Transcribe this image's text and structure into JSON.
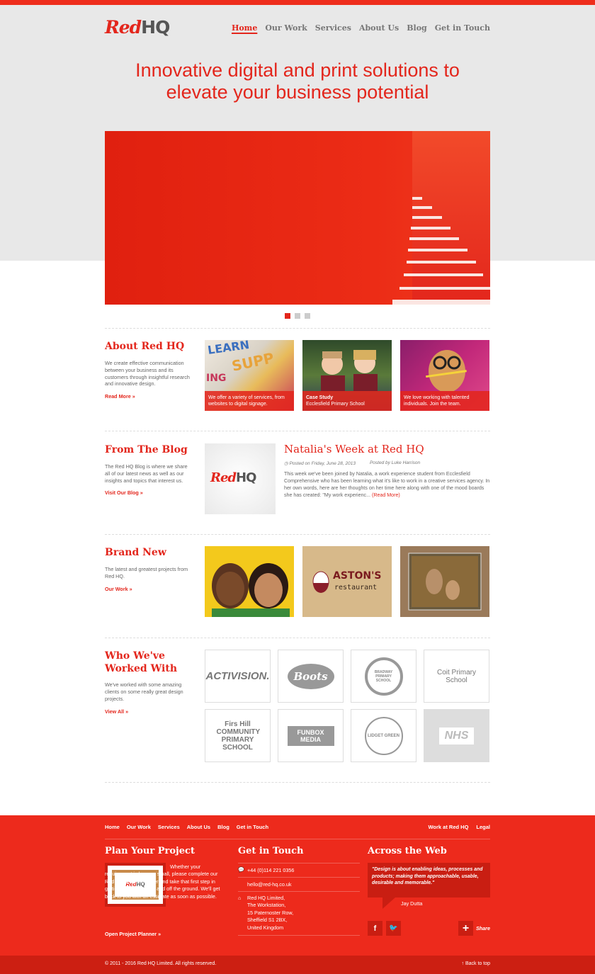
{
  "brand": {
    "logo_red": "Red",
    "logo_grey": "HQ"
  },
  "nav": [
    {
      "label": "Home",
      "active": true
    },
    {
      "label": "Our Work"
    },
    {
      "label": "Services"
    },
    {
      "label": "About Us"
    },
    {
      "label": "Blog"
    },
    {
      "label": "Get in Touch"
    }
  ],
  "hero": {
    "tagline_line1": "Innovative digital and print solutions to",
    "tagline_line2": "elevate your business potential"
  },
  "about": {
    "title": "About Red HQ",
    "text": "We create effective communication between your business and its customers through insightful research and innovative design.",
    "link": "Read More »",
    "tiles": [
      {
        "caption": "We offer a variety of services, from websites to digital signage."
      },
      {
        "caption_bold": "Case Study",
        "caption": "Ecclesfield Primary School"
      },
      {
        "caption": "We love working with talented individuals. Join the team."
      }
    ]
  },
  "blog": {
    "title": "From The Blog",
    "text": "The Red HQ Blog is where we share all of our latest news as well as our insights and topics that interest us.",
    "link": "Visit Our Blog »",
    "post_title": "Natalia's Week at Red HQ",
    "post_date": "Posted on Friday, June 28, 2013",
    "post_author": "Posted by Luke Harrison",
    "excerpt": "This week we've been joined by Natalia, a work experience student from Ecclesfield Comprehensive who has been learning what it's like to work in a creative services agency. In her own words, here are her thoughts on her time here along with one of the mood boards she has created: \"My work experienc...",
    "read_more": "(Read More)",
    "thumb_logo_red": "Red",
    "thumb_logo_grey": "HQ"
  },
  "brand_new": {
    "title": "Brand New",
    "text": "The latest and greatest projects from Red HQ.",
    "link": "Our Work »",
    "aston_name": "ASTON'S",
    "aston_sub": "restaurant"
  },
  "clients": {
    "title_line1": "Who We've",
    "title_line2": "Worked With",
    "text": "We've worked with some amazing clients on some really great design projects.",
    "link": "View All »",
    "logos": [
      "ACTIVISION.",
      "Boots",
      "BRADWAY PRIMARY SCHOOL",
      "Coit Primary School",
      "Firs Hill COMMUNITY PRIMARY SCHOOL",
      "FUNBOX MEDIA",
      "LIDGET GREEN",
      "NHS"
    ]
  },
  "footer": {
    "nav_left": [
      "Home",
      "Our Work",
      "Services",
      "About Us",
      "Blog",
      "Get in Touch"
    ],
    "nav_right": [
      "Work at Red HQ",
      "Legal"
    ],
    "plan_title": "Plan Your Project",
    "plan_text": "Whether your requirement is large or small, please complete our Red HQ project planner and take that first step in getting your project up and off the ground. We'll get back to you with an estimate as soon as possible.",
    "plan_link": "Open Project Planner »",
    "contact_title": "Get in Touch",
    "phone": "+44 (0)114 221 0356",
    "email": "hello@red-hq.co.uk",
    "address": [
      "Red HQ Limited,",
      "The Workstation,",
      "15 Paternoster Row,",
      "Sheffield S1 2BX,",
      "United Kingdom"
    ],
    "web_title": "Across the Web",
    "quote": "\"Design is about enabling ideas, processes and products; making them approachable, usable, desirable and memorable.\"",
    "quote_author": "Jay Dutta",
    "share": "Share",
    "copyright": "© 2011 - 2016 Red HQ Limited. All rights reserved.",
    "back_to_top": "Back to top"
  },
  "colors": {
    "accent": "#e3261c",
    "footer": "#ed2a1c",
    "hero_bg": "#e8e8e8"
  }
}
